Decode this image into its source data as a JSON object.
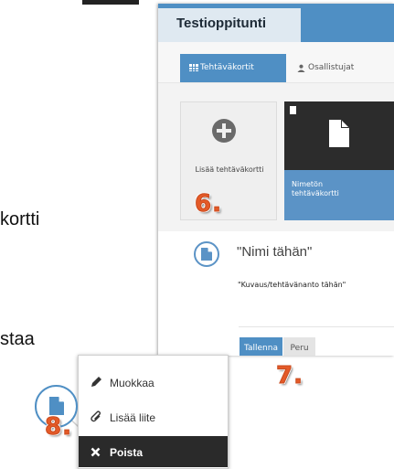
{
  "background_doc": {
    "line1": "kortti",
    "line2": "staa"
  },
  "app": {
    "title": "Testioppitunti",
    "tabs": [
      {
        "label": "Tehtäväkortit",
        "active": true,
        "icon": "grid-icon"
      },
      {
        "label": "Osallistujat",
        "active": false,
        "icon": "user-icon"
      }
    ],
    "add_card_label": "Lisää tehtäväkortti",
    "new_card_name": "Nimetön tehtäväkortti",
    "name_placeholder": "\"Nimi tähän\"",
    "description_placeholder": "\"Kuvaus/tehtävänanto tähän\"",
    "save_label": "Tallenna",
    "cancel_label": "Peru"
  },
  "steps": {
    "s6": "6.",
    "s7": "7.",
    "s8": "8."
  },
  "menu": {
    "items": [
      {
        "label": "Muokkaa",
        "icon": "pencil-icon",
        "active": false
      },
      {
        "label": "Lisää liite",
        "icon": "paperclip-icon",
        "active": false
      },
      {
        "label": "Poista",
        "icon": "close-icon",
        "active": true
      }
    ]
  },
  "colors": {
    "accent": "#4f8fc4",
    "card_blue": "#5b93c6",
    "step_orange": "#e45a28",
    "menu_active": "#2a2a2a"
  }
}
